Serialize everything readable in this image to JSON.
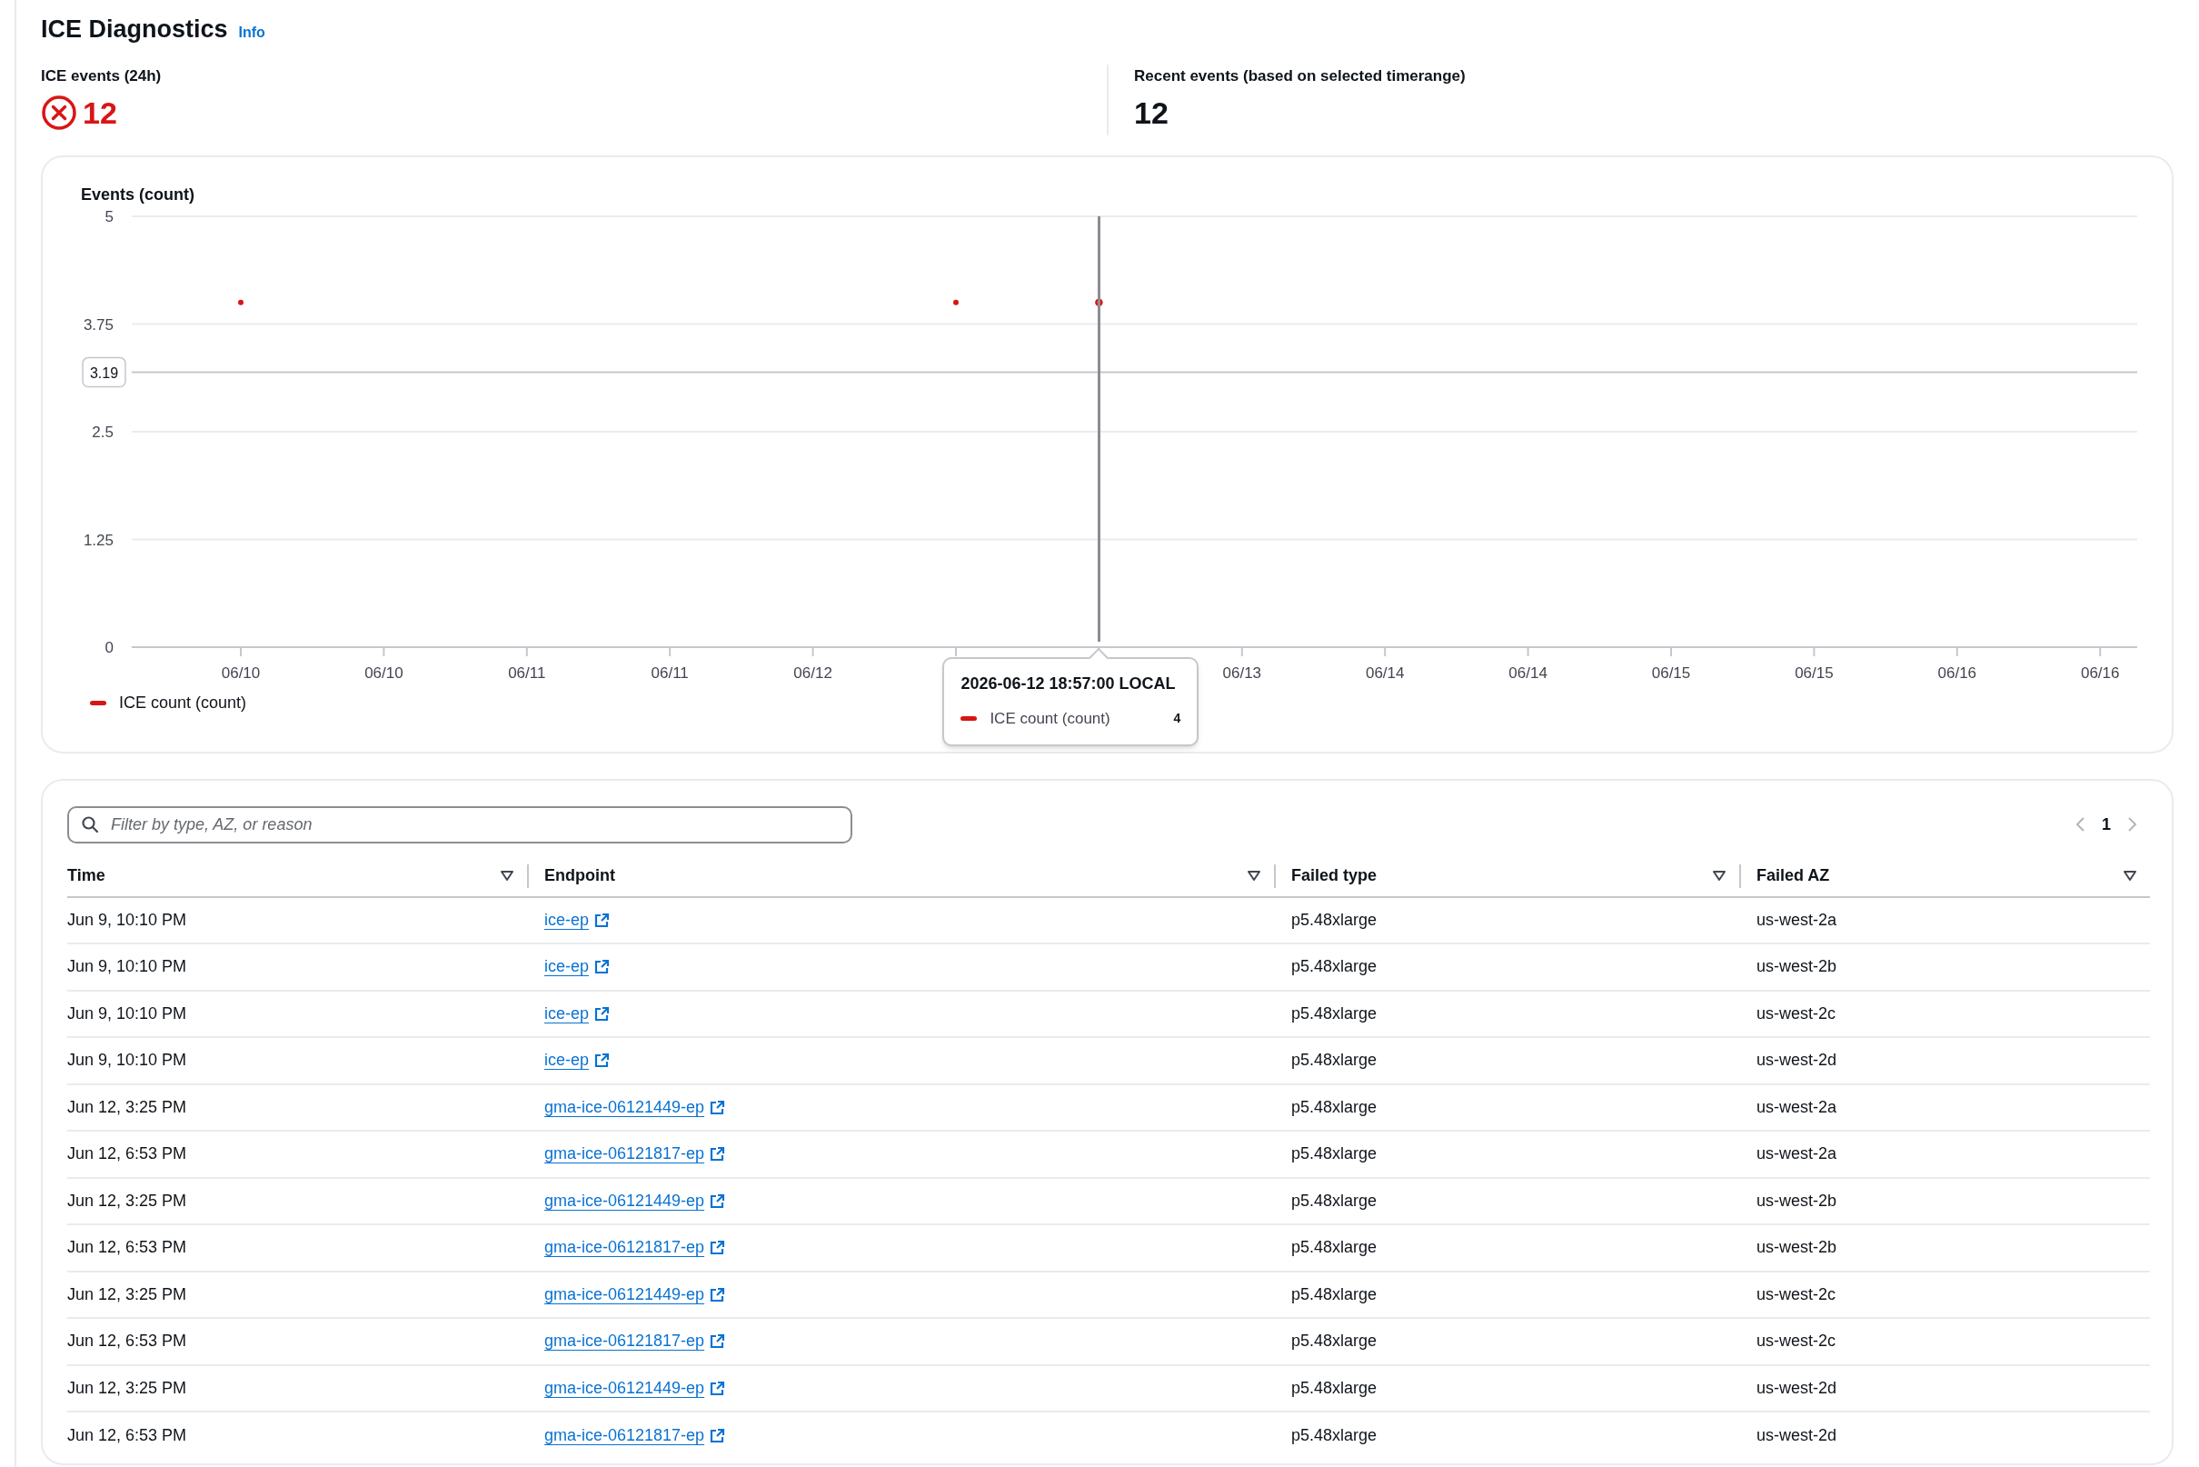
{
  "header": {
    "title": "ICE Diagnostics",
    "info_link": "Info"
  },
  "metrics": [
    {
      "label": "ICE events (24h)",
      "value": "12",
      "alert": true
    },
    {
      "label": "Recent events (based on selected timerange)",
      "value": "12",
      "alert": false
    }
  ],
  "chart": {
    "chart_data": {
      "type": "scatter",
      "title": "Events (count)",
      "categories": [
        "06/10",
        "06/10",
        "06/11",
        "06/11",
        "06/12",
        null,
        null,
        "06/13",
        "06/14",
        "06/14",
        "06/15",
        "06/15",
        "06/16",
        "06/16"
      ],
      "series": [
        {
          "name": "ICE count (count)",
          "color": "#d91515",
          "values": [
            4,
            null,
            null,
            null,
            null,
            4,
            4,
            null,
            null,
            null,
            null,
            null,
            null,
            null
          ]
        }
      ],
      "ylim": [
        0,
        5
      ],
      "yticks": [
        0,
        1.25,
        2.5,
        3.75,
        5
      ],
      "grid": true,
      "ref_lines": [
        {
          "axis": "y",
          "value": 3.19,
          "label": "3.19"
        }
      ]
    },
    "tooltip": {
      "title": "2026-06-12 18:57:00 LOCAL",
      "series": "ICE count (count)",
      "value": "4"
    }
  },
  "table": {
    "search": {
      "placeholder": "Filter by type, AZ, or reason"
    },
    "pagination": {
      "page": "1",
      "previous_disabled": true,
      "next_disabled": true
    },
    "columns": [
      "Time",
      "Endpoint",
      "Failed type",
      "Failed AZ"
    ],
    "rows": [
      {
        "time": "Jun 9, 10:10 PM",
        "endpoint": "ice-ep",
        "failed_type": "p5.48xlarge",
        "failed_az": "us-west-2a"
      },
      {
        "time": "Jun 9, 10:10 PM",
        "endpoint": "ice-ep",
        "failed_type": "p5.48xlarge",
        "failed_az": "us-west-2b"
      },
      {
        "time": "Jun 9, 10:10 PM",
        "endpoint": "ice-ep",
        "failed_type": "p5.48xlarge",
        "failed_az": "us-west-2c"
      },
      {
        "time": "Jun 9, 10:10 PM",
        "endpoint": "ice-ep",
        "failed_type": "p5.48xlarge",
        "failed_az": "us-west-2d"
      },
      {
        "time": "Jun 12, 3:25 PM",
        "endpoint": "gma-ice-06121449-ep",
        "failed_type": "p5.48xlarge",
        "failed_az": "us-west-2a"
      },
      {
        "time": "Jun 12, 6:53 PM",
        "endpoint": "gma-ice-06121817-ep",
        "failed_type": "p5.48xlarge",
        "failed_az": "us-west-2a"
      },
      {
        "time": "Jun 12, 3:25 PM",
        "endpoint": "gma-ice-06121449-ep",
        "failed_type": "p5.48xlarge",
        "failed_az": "us-west-2b"
      },
      {
        "time": "Jun 12, 6:53 PM",
        "endpoint": "gma-ice-06121817-ep",
        "failed_type": "p5.48xlarge",
        "failed_az": "us-west-2b"
      },
      {
        "time": "Jun 12, 3:25 PM",
        "endpoint": "gma-ice-06121449-ep",
        "failed_type": "p5.48xlarge",
        "failed_az": "us-west-2c"
      },
      {
        "time": "Jun 12, 6:53 PM",
        "endpoint": "gma-ice-06121817-ep",
        "failed_type": "p5.48xlarge",
        "failed_az": "us-west-2c"
      },
      {
        "time": "Jun 12, 3:25 PM",
        "endpoint": "gma-ice-06121449-ep",
        "failed_type": "p5.48xlarge",
        "failed_az": "us-west-2d"
      },
      {
        "time": "Jun 12, 6:53 PM",
        "endpoint": "gma-ice-06121817-ep",
        "failed_type": "p5.48xlarge",
        "failed_az": "us-west-2d"
      }
    ]
  }
}
